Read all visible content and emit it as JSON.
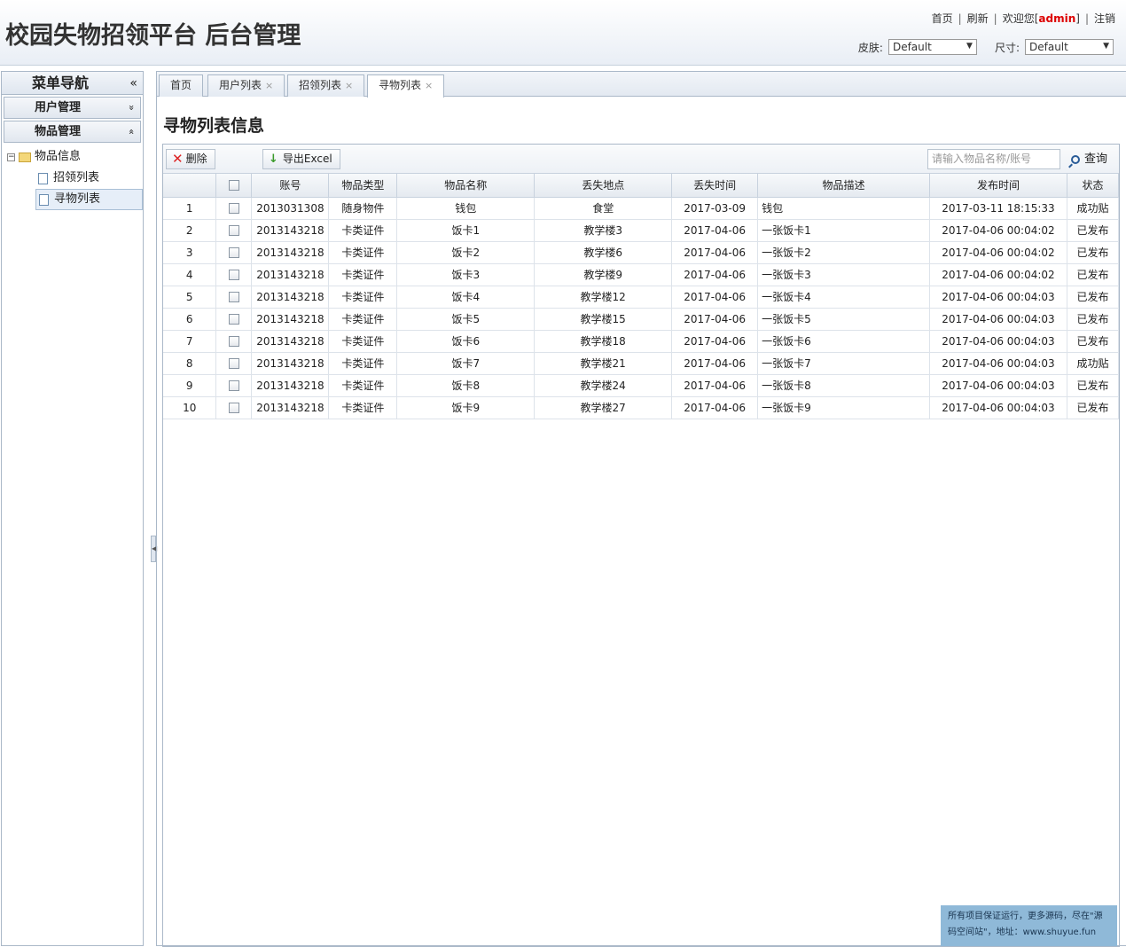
{
  "header": {
    "title": "校园失物招领平台 后台管理",
    "links": {
      "home": "首页",
      "refresh": "刷新",
      "welcome_prefix": "欢迎您[",
      "username": "admin",
      "welcome_suffix": "]",
      "logout": "注销"
    },
    "skin_label": "皮肤:",
    "skin_value": "Default",
    "size_label": "尺寸:",
    "size_value": "Default"
  },
  "sidebar": {
    "title": "菜单导航",
    "collapse_glyph": "«",
    "groups": [
      {
        "label": "用户管理",
        "toggle": "»"
      },
      {
        "label": "物品管理",
        "toggle": "«"
      }
    ],
    "tree": {
      "root": "物品信息",
      "children": [
        "招领列表",
        "寻物列表"
      ]
    }
  },
  "tabs": [
    {
      "label": "首页"
    },
    {
      "label": "用户列表",
      "close": "×"
    },
    {
      "label": "招领列表",
      "close": "×"
    },
    {
      "label": "寻物列表",
      "close": "×"
    }
  ],
  "page_title": "寻物列表信息",
  "toolbar": {
    "delete_label": "删除",
    "export_label": "导出Excel",
    "search_placeholder": "请输入物品名称/账号",
    "search_label": "查询"
  },
  "table": {
    "columns": [
      "",
      "",
      "账号",
      "物品类型",
      "物品名称",
      "丢失地点",
      "丢失时间",
      "物品描述",
      "发布时间",
      "状态"
    ],
    "rows": [
      [
        "1",
        "2013031308",
        "随身物件",
        "钱包",
        "食堂",
        "2017-03-09",
        "钱包",
        "2017-03-11 18:15:33",
        "成功贴"
      ],
      [
        "2",
        "2013143218",
        "卡类证件",
        "饭卡1",
        "教学楼3",
        "2017-04-06",
        "一张饭卡1",
        "2017-04-06 00:04:02",
        "已发布"
      ],
      [
        "3",
        "2013143218",
        "卡类证件",
        "饭卡2",
        "教学楼6",
        "2017-04-06",
        "一张饭卡2",
        "2017-04-06 00:04:02",
        "已发布"
      ],
      [
        "4",
        "2013143218",
        "卡类证件",
        "饭卡3",
        "教学楼9",
        "2017-04-06",
        "一张饭卡3",
        "2017-04-06 00:04:02",
        "已发布"
      ],
      [
        "5",
        "2013143218",
        "卡类证件",
        "饭卡4",
        "教学楼12",
        "2017-04-06",
        "一张饭卡4",
        "2017-04-06 00:04:03",
        "已发布"
      ],
      [
        "6",
        "2013143218",
        "卡类证件",
        "饭卡5",
        "教学楼15",
        "2017-04-06",
        "一张饭卡5",
        "2017-04-06 00:04:03",
        "已发布"
      ],
      [
        "7",
        "2013143218",
        "卡类证件",
        "饭卡6",
        "教学楼18",
        "2017-04-06",
        "一张饭卡6",
        "2017-04-06 00:04:03",
        "已发布"
      ],
      [
        "8",
        "2013143218",
        "卡类证件",
        "饭卡7",
        "教学楼21",
        "2017-04-06",
        "一张饭卡7",
        "2017-04-06 00:04:03",
        "成功贴"
      ],
      [
        "9",
        "2013143218",
        "卡类证件",
        "饭卡8",
        "教学楼24",
        "2017-04-06",
        "一张饭卡8",
        "2017-04-06 00:04:03",
        "已发布"
      ],
      [
        "10",
        "2013143218",
        "卡类证件",
        "饭卡9",
        "教学楼27",
        "2017-04-06",
        "一张饭卡9",
        "2017-04-06 00:04:03",
        "已发布"
      ]
    ]
  },
  "footer_note": "所有项目保证运行，更多源码，尽在\"源码空间站\"，地址：www.shuyue.fun",
  "colors": {
    "username": "#dd0000",
    "accent_border": "#aab8c8",
    "footer_bg": "#8fb9d8"
  }
}
